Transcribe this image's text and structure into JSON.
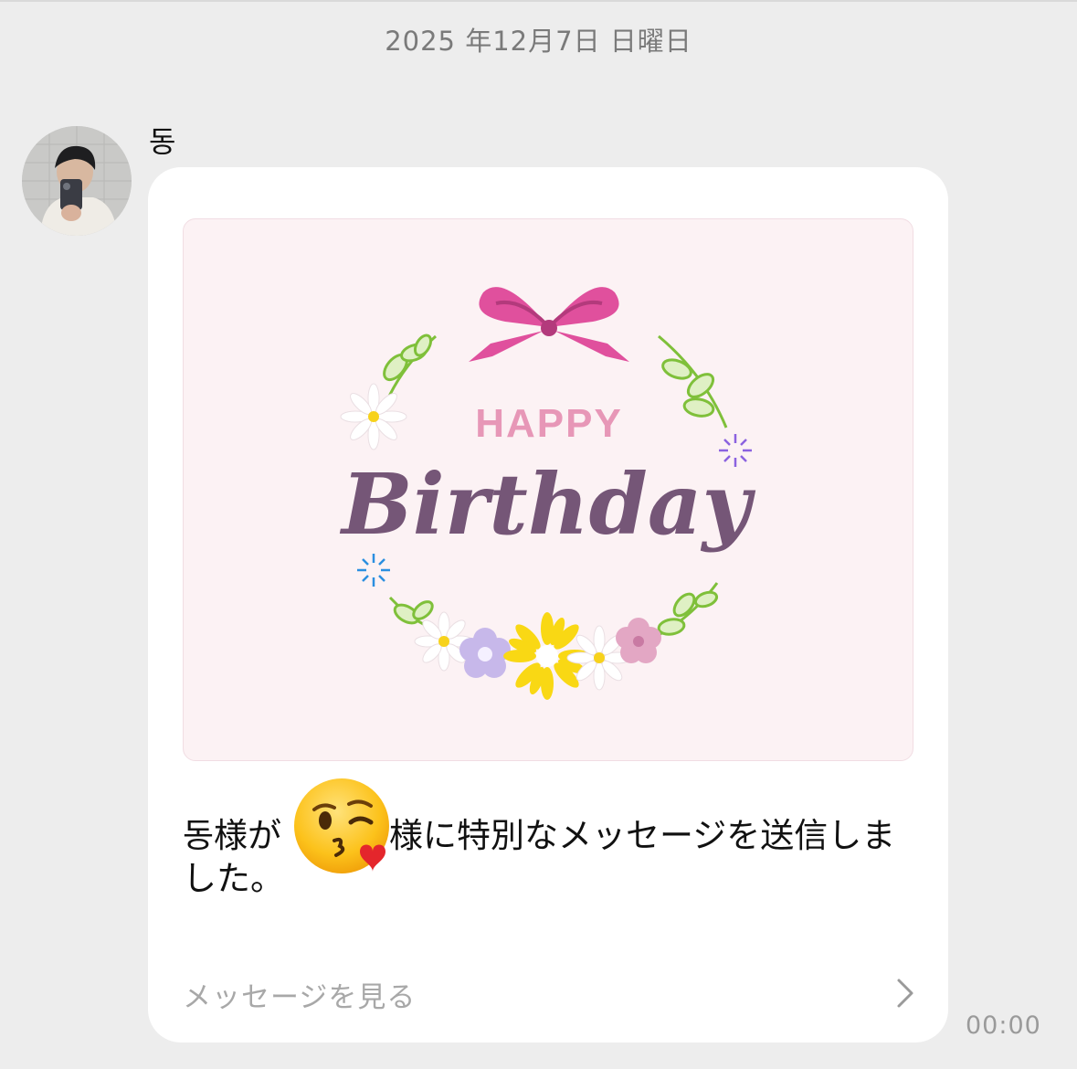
{
  "header": {
    "date": "2025 年12月7日 日曜日"
  },
  "chat": {
    "sender_name": "동",
    "message": {
      "card": {
        "happy": "HAPPY",
        "birthday": "Birthday"
      },
      "text_part1": "동様が",
      "text_part2": "様に特別なメッセージを送信しました。",
      "link_label": "メッセージを見る",
      "time": "00:00"
    }
  },
  "icons": {
    "avatar": "user-avatar-photo",
    "emoji": "face-blowing-kiss-icon",
    "chevron": "chevron-right-icon"
  },
  "colors": {
    "background": "#ededed",
    "bubble": "#ffffff",
    "card_background": "#fcf2f4",
    "happy_text": "#e797b7",
    "birthday_text": "#755677",
    "ribbon": "#e0509d"
  }
}
